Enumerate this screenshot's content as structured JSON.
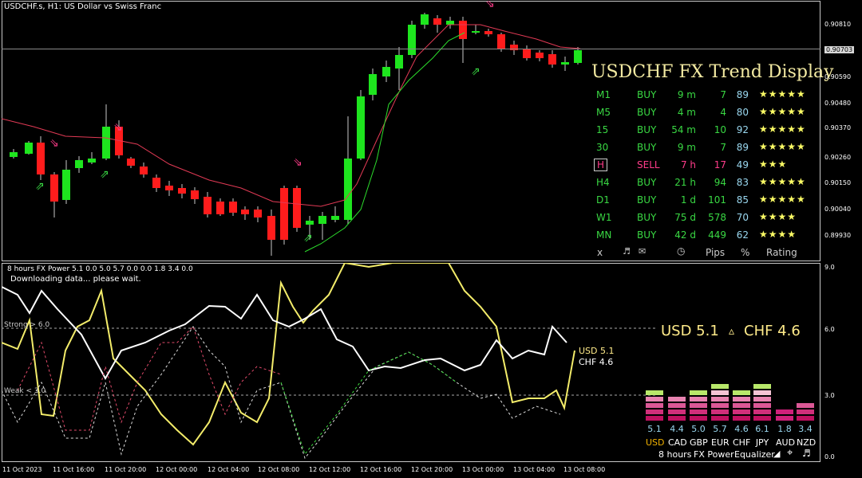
{
  "header": {
    "symbol_line": "USDCHF.s, H1:  US Dollar vs Swiss Franc"
  },
  "price_axis": {
    "labels": [
      "0.90810",
      "0.90703",
      "0.90590",
      "0.90480",
      "0.90370",
      "0.90260",
      "0.90150",
      "0.90040",
      "0.89930"
    ],
    "current_price": "0.90703"
  },
  "trend_display": {
    "title": "USDCHF FX Trend Display",
    "rows": [
      {
        "tf": "M1",
        "signal": "BUY",
        "time": "9 m",
        "pips": "7",
        "pct": "89",
        "stars": "★★★★★",
        "selected": false
      },
      {
        "tf": "M5",
        "signal": "BUY",
        "time": "4 m",
        "pips": "4",
        "pct": "80",
        "stars": "★★★★★",
        "selected": false
      },
      {
        "tf": "15",
        "signal": "BUY",
        "time": "54 m",
        "pips": "10",
        "pct": "92",
        "stars": "★★★★★",
        "selected": false
      },
      {
        "tf": "30",
        "signal": "BUY",
        "time": "9 m",
        "pips": "7",
        "pct": "89",
        "stars": "★★★★★",
        "selected": false
      },
      {
        "tf": "H",
        "signal": "SELL",
        "time": "7 h",
        "pips": "17",
        "pct": "49",
        "stars": "★★★",
        "selected": true
      },
      {
        "tf": "H4",
        "signal": "BUY",
        "time": "21 h",
        "pips": "94",
        "pct": "83",
        "stars": "★★★★★",
        "selected": false
      },
      {
        "tf": "D1",
        "signal": "BUY",
        "time": "1 d",
        "pips": "101",
        "pct": "85",
        "stars": "★★★★★",
        "selected": false
      },
      {
        "tf": "W1",
        "signal": "BUY",
        "time": "75 d",
        "pips": "578",
        "pct": "70",
        "stars": "★★★★",
        "selected": false
      },
      {
        "tf": "MN",
        "signal": "BUY",
        "time": "42 d",
        "pips": "449",
        "pct": "62",
        "stars": "★★★★",
        "selected": false
      }
    ],
    "footer": {
      "close": "x",
      "pips": "Pips",
      "pct": "%",
      "rating": "Rating"
    },
    "colors": {
      "buy": "#39d843",
      "sell": "#ff3c8a",
      "num": "#9ad8f0"
    }
  },
  "subwindow": {
    "title": "8 hours FX Power 5.1 0.0 5.0 5.7 0.0 0.0 1.8 3.4 0.0",
    "status": "Downloading data... please wait.",
    "strong_label": "Strong > 6.0",
    "weak_label": "Weak < 3.0",
    "axis_labels": [
      "9.0",
      "6.0",
      "3.0",
      "0.0"
    ],
    "legend_usd": "USD 5.1",
    "legend_chf": "CHF 4.6",
    "big_usd": "USD 5.1",
    "big_arrow": "▵",
    "big_chf": "CHF 4.6"
  },
  "equalizer": {
    "values": [
      "5.1",
      "4.4",
      "5.0",
      "5.7",
      "4.6",
      "6.1",
      "1.8",
      "3.4"
    ],
    "currencies": [
      "USD",
      "CAD",
      "GBP",
      "EUR",
      "CHF",
      "JPY",
      "AUD",
      "NZD"
    ],
    "bottom_labels": {
      "period": "8 hours",
      "power": "FX Power",
      "eq": "Equalizer"
    }
  },
  "time_axis": {
    "labels": [
      "11 Oct 2023",
      "11 Oct 16:00",
      "11 Oct 20:00",
      "12 Oct 00:00",
      "12 Oct 04:00",
      "12 Oct 08:00",
      "12 Oct 12:00",
      "12 Oct 16:00",
      "12 Oct 20:00",
      "13 Oct 00:00",
      "13 Oct 04:00",
      "13 Oct 08:00"
    ]
  },
  "chart_data": {
    "type": "line",
    "title": "8 hours FX Power",
    "xlabel": "",
    "ylabel": "",
    "ylim": [
      0,
      9
    ],
    "series": [
      {
        "name": "USD",
        "values": [
          7.1,
          6.2,
          7.0,
          5.9,
          4.8,
          6.5,
          5.2,
          5.8,
          5.5,
          6.2,
          7.0,
          6.4,
          6.9,
          5.8,
          7.0,
          6.3,
          5.0,
          5.1,
          5.3,
          4.6,
          5.4,
          5.1
        ]
      },
      {
        "name": "CHF",
        "values": [
          5.5,
          7.2,
          3.5,
          2.0,
          4.2,
          5.7,
          5.4,
          3.0,
          4.6,
          5.0,
          4.6
        ]
      }
    ]
  }
}
